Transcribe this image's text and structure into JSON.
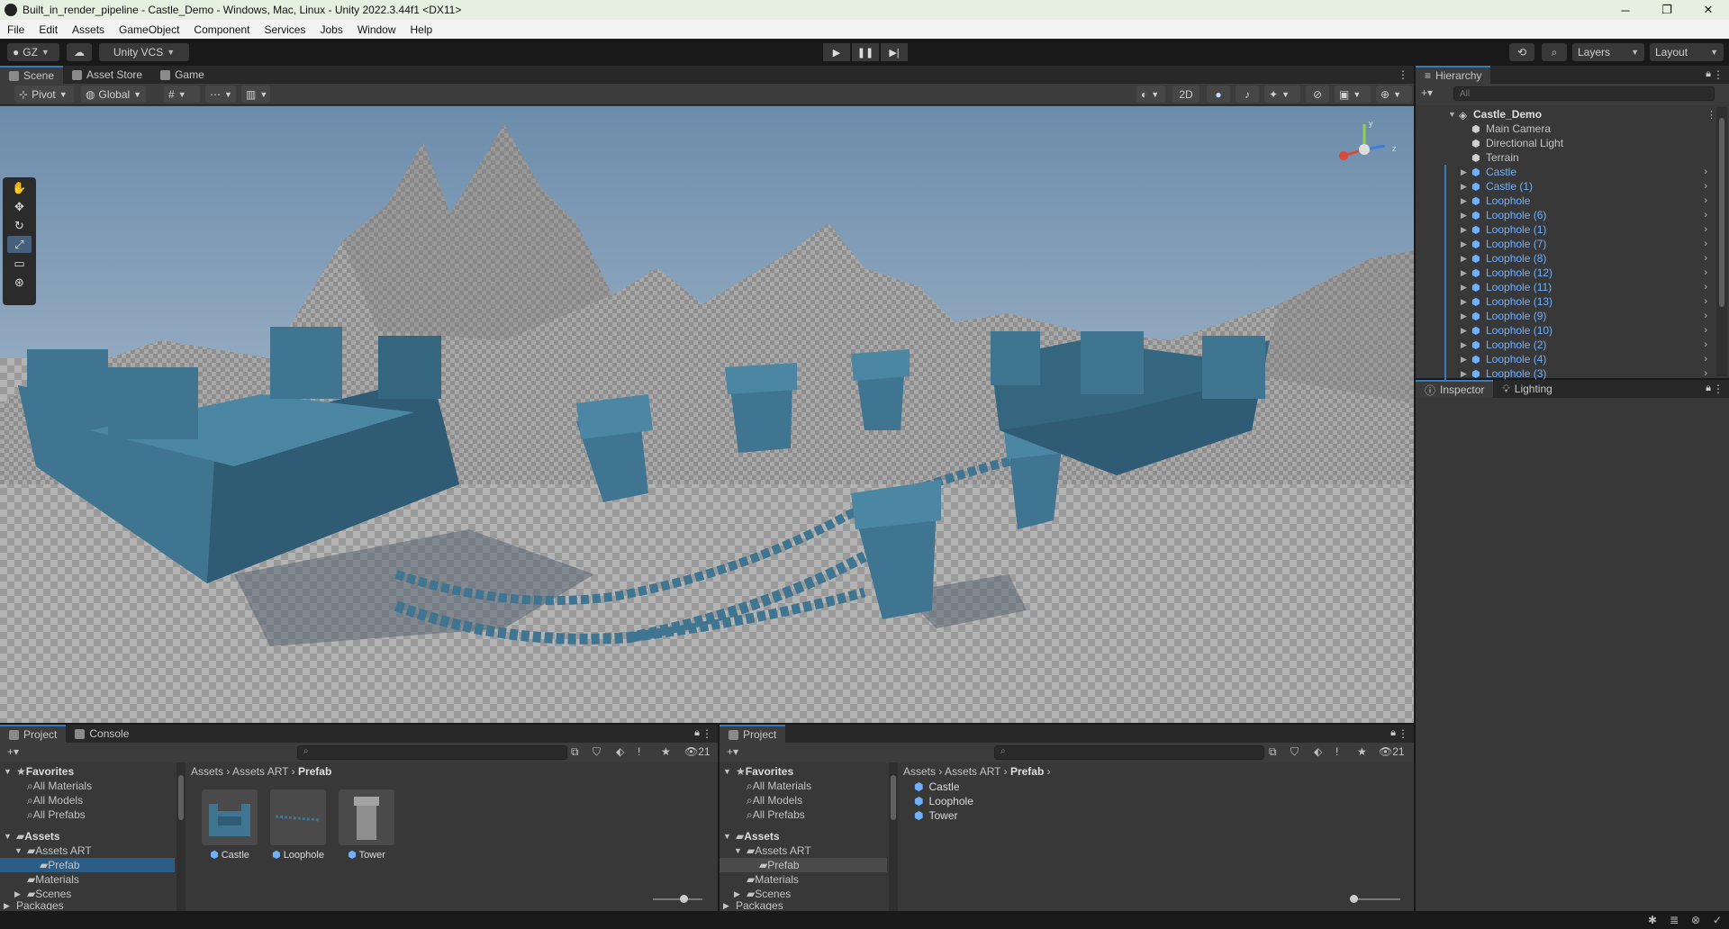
{
  "window": {
    "title": "Built_in_render_pipeline - Castle_Demo - Windows, Mac, Linux - Unity 2022.3.44f1 <DX11>",
    "controls": [
      "minimize-icon",
      "maximize-icon",
      "close-icon"
    ]
  },
  "menu": [
    "File",
    "Edit",
    "Assets",
    "GameObject",
    "Component",
    "Services",
    "Jobs",
    "Window",
    "Help"
  ],
  "toolbar": {
    "account": "GZ",
    "vcs": "Unity VCS",
    "layers": "Layers",
    "layout": "Layout"
  },
  "scene_tabs": [
    "Scene",
    "Asset Store",
    "Game"
  ],
  "scene_toolbar": {
    "pivot": "Pivot",
    "global": "Global",
    "mode_2d": "2D"
  },
  "hierarchy": {
    "tab": "Hierarchy",
    "search_placeholder": "All",
    "scene": "Castle_Demo",
    "items": [
      {
        "label": "Main Camera",
        "prefab": false
      },
      {
        "label": "Directional Light",
        "prefab": false
      },
      {
        "label": "Terrain",
        "prefab": false
      },
      {
        "label": "Castle",
        "prefab": true
      },
      {
        "label": "Castle (1)",
        "prefab": true
      },
      {
        "label": "Loophole",
        "prefab": true
      },
      {
        "label": "Loophole (6)",
        "prefab": true
      },
      {
        "label": "Loophole (1)",
        "prefab": true
      },
      {
        "label": "Loophole (7)",
        "prefab": true
      },
      {
        "label": "Loophole (8)",
        "prefab": true
      },
      {
        "label": "Loophole (12)",
        "prefab": true
      },
      {
        "label": "Loophole (11)",
        "prefab": true
      },
      {
        "label": "Loophole (13)",
        "prefab": true
      },
      {
        "label": "Loophole (9)",
        "prefab": true
      },
      {
        "label": "Loophole (10)",
        "prefab": true
      },
      {
        "label": "Loophole (2)",
        "prefab": true
      },
      {
        "label": "Loophole (4)",
        "prefab": true
      },
      {
        "label": "Loophole (3)",
        "prefab": true
      }
    ]
  },
  "inspector_tabs": [
    "Inspector",
    "Lighting"
  ],
  "project_left": {
    "tabs": [
      "Project",
      "Console"
    ],
    "count": "21",
    "breadcrumb": [
      "Assets",
      "Assets ART",
      "Prefab"
    ],
    "tree": {
      "favorites": "Favorites",
      "fav_items": [
        "All Materials",
        "All Models",
        "All Prefabs"
      ],
      "assets": "Assets",
      "assets_art": "Assets ART",
      "prefab": "Prefab",
      "materials": "Materials",
      "scenes": "Scenes",
      "packages": "Packages"
    },
    "grid": [
      "Castle",
      "Loophole",
      "Tower"
    ]
  },
  "project_right": {
    "tab": "Project",
    "count": "21",
    "breadcrumb": [
      "Assets",
      "Assets ART",
      "Prefab"
    ],
    "tree": {
      "favorites": "Favorites",
      "fav_items": [
        "All Materials",
        "All Models",
        "All Prefabs"
      ],
      "assets": "Assets",
      "assets_art": "Assets ART",
      "prefab": "Prefab",
      "materials": "Materials",
      "scenes": "Scenes",
      "packages": "Packages"
    },
    "list": [
      "Castle",
      "Loophole",
      "Tower"
    ]
  },
  "colors": {
    "accent": "#3a79bb",
    "prefab_text": "#6fb1ff",
    "castle": "#3f7590"
  }
}
